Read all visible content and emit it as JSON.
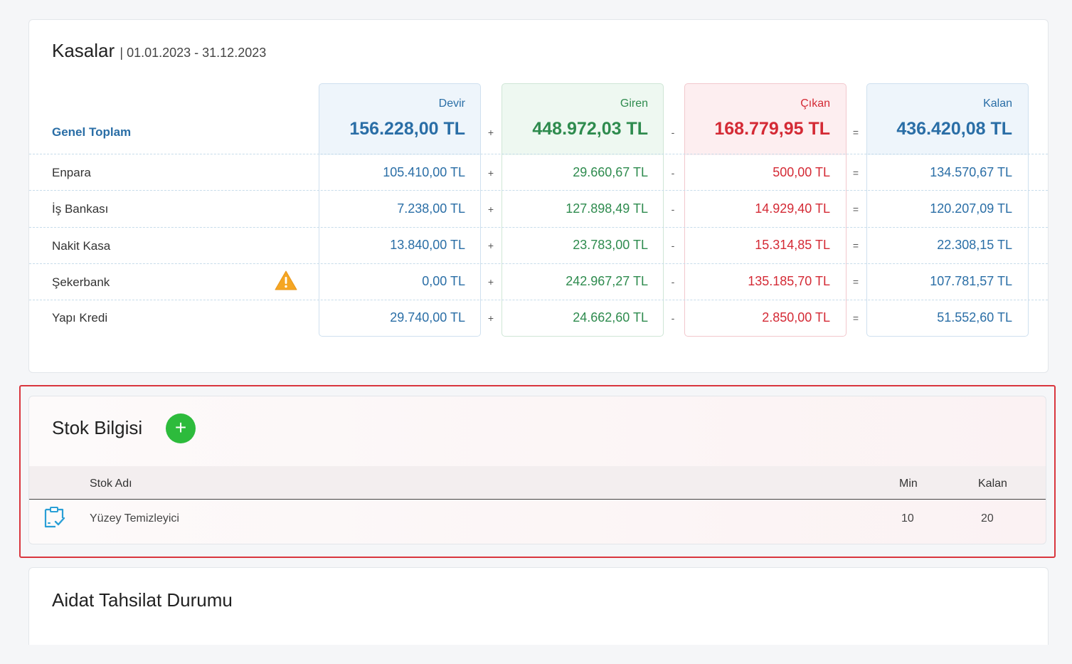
{
  "kasalar": {
    "title": "Kasalar",
    "date_range": "| 01.01.2023 - 31.12.2023",
    "columns": {
      "devir": "Devir",
      "giren": "Giren",
      "cikan": "Çıkan",
      "kalan": "Kalan"
    },
    "operators": {
      "plus": "+",
      "minus": "-",
      "equals": "="
    },
    "genel_toplam": {
      "label": "Genel Toplam",
      "devir": "156.228,00 TL",
      "giren": "448.972,03 TL",
      "cikan": "168.779,95 TL",
      "kalan": "436.420,08 TL"
    },
    "rows": [
      {
        "name": "Enpara",
        "devir": "105.410,00 TL",
        "giren": "29.660,67 TL",
        "cikan": "500,00 TL",
        "kalan": "134.570,67 TL",
        "warning": false
      },
      {
        "name": "İş Bankası",
        "devir": "7.238,00 TL",
        "giren": "127.898,49 TL",
        "cikan": "14.929,40 TL",
        "kalan": "120.207,09 TL",
        "warning": false
      },
      {
        "name": "Nakit Kasa",
        "devir": "13.840,00 TL",
        "giren": "23.783,00 TL",
        "cikan": "15.314,85 TL",
        "kalan": "22.308,15 TL",
        "warning": false
      },
      {
        "name": "Şekerbank",
        "devir": "0,00 TL",
        "giren": "242.967,27 TL",
        "cikan": "135.185,70 TL",
        "kalan": "107.781,57 TL",
        "warning": true,
        "warning_icon": "warning-triangle-icon"
      },
      {
        "name": "Yapı Kredi",
        "devir": "29.740,00 TL",
        "giren": "24.662,60 TL",
        "cikan": "2.850,00 TL",
        "kalan": "51.552,60 TL",
        "warning": false
      }
    ],
    "colors": {
      "devir": "#2a6ea6",
      "giren": "#2e8b4e",
      "cikan": "#d42a35",
      "kalan": "#2a6ea6"
    }
  },
  "stok": {
    "title": "Stok Bilgisi",
    "add_button": "+",
    "add_icon": "plus-circle-icon",
    "headers": {
      "name": "Stok Adı",
      "min": "Min",
      "kalan": "Kalan"
    },
    "items": [
      {
        "icon": "clipboard-check-icon",
        "name": "Yüzey Temizleyici",
        "min": "10",
        "kalan": "20"
      }
    ],
    "highlight_color": "#d9363e"
  },
  "aidat": {
    "title": "Aidat Tahsilat Durumu"
  }
}
